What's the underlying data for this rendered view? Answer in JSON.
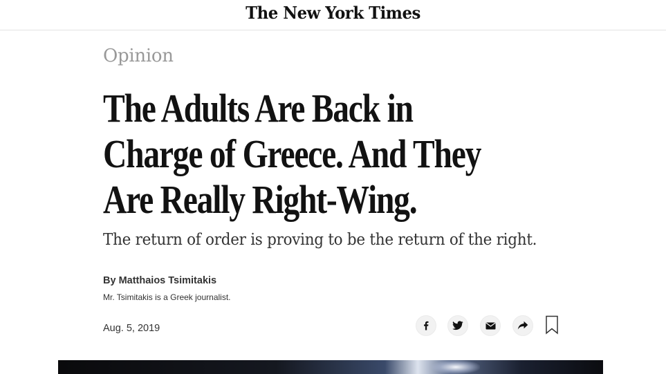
{
  "masthead": {
    "logo_text": "The New York Times"
  },
  "article": {
    "kicker": "Opinion",
    "headline_lines": [
      "The Adults Are Back in",
      "Charge of Greece. And They",
      "Are Really Right-Wing."
    ],
    "summary": "The return of order is proving to be the return of the right.",
    "byline": "By Matthaios Tsimitakis",
    "author_bio": "Mr. Tsimitakis is a Greek journalist.",
    "date": "Aug. 5, 2019"
  },
  "share_tools": {
    "icons": [
      "facebook-icon",
      "twitter-icon",
      "email-icon",
      "share-arrow-icon",
      "bookmark-icon"
    ]
  },
  "colors": {
    "text": "#121212",
    "kicker": "#999999",
    "icon_bg": "#f2f2f2"
  }
}
